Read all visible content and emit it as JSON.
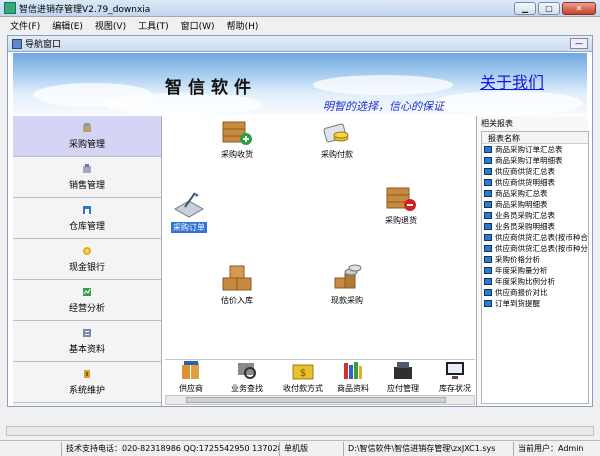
{
  "window": {
    "title": "智信进销存管理V2.79_downxia",
    "btn_min": "▁",
    "btn_max": "□",
    "btn_close": "✕"
  },
  "menu": [
    "文件(F)",
    "编辑(E)",
    "视图(V)",
    "工具(T)",
    "窗口(W)",
    "帮助(H)"
  ],
  "nav_window": {
    "title": "导航窗口",
    "min": "—"
  },
  "banner": {
    "brand": "智信软件",
    "about": "关于我们",
    "slogan": "明智的选择，信心的保证"
  },
  "sidebar": [
    {
      "label": "采购管理",
      "icon": "purchase-icon",
      "active": true
    },
    {
      "label": "销售管理",
      "icon": "sales-icon"
    },
    {
      "label": "仓库管理",
      "icon": "warehouse-icon"
    },
    {
      "label": "现金银行",
      "icon": "cash-icon"
    },
    {
      "label": "经营分析",
      "icon": "analysis-icon"
    },
    {
      "label": "基本资料",
      "icon": "info-icon"
    },
    {
      "label": "系统维护",
      "icon": "maintenance-icon"
    }
  ],
  "tiles": [
    {
      "label": "采购收货",
      "icon": "box-add-icon"
    },
    {
      "label": "采购付款",
      "icon": "payment-icon"
    },
    {
      "label": "采购订单",
      "icon": "order-icon",
      "selected": true
    },
    {
      "label": "采购退货",
      "icon": "box-remove-icon"
    },
    {
      "label": "估价入库",
      "icon": "boxes-icon"
    },
    {
      "label": "现款采购",
      "icon": "cash-purchase-icon"
    }
  ],
  "toolbar": [
    "供应商",
    "业务查找",
    "收付款方式",
    "商品资料",
    "应付管理",
    "库存状况"
  ],
  "reports": {
    "title": "相关报表",
    "header": "报表名称",
    "items": [
      "商品采购订单汇总表",
      "商品采购订单明细表",
      "供应商供货汇总表",
      "供应商供货明细表",
      "商品采购汇总表",
      "商品采购明细表",
      "业务员采购汇总表",
      "业务员采购明细表",
      "供应商供货汇总表(按币种合并)",
      "供应商供货汇总表(按币种分开)",
      "采购价格分析",
      "年度采购量分析",
      "年度采购比例分析",
      "供应商报价对比",
      "订单到货提醒"
    ]
  },
  "status": {
    "phone": "技术支持电话：020-82318986 QQ:1725542950 137028856",
    "edition": "单机版",
    "path": "D:\\智信软件\\智信进销存管理\\zxJXC1.sys",
    "user": "当前用户：Admin"
  },
  "colors": {
    "accent": "#3372d8",
    "active_side": "#d4d4f4",
    "link": "#1616e0"
  }
}
